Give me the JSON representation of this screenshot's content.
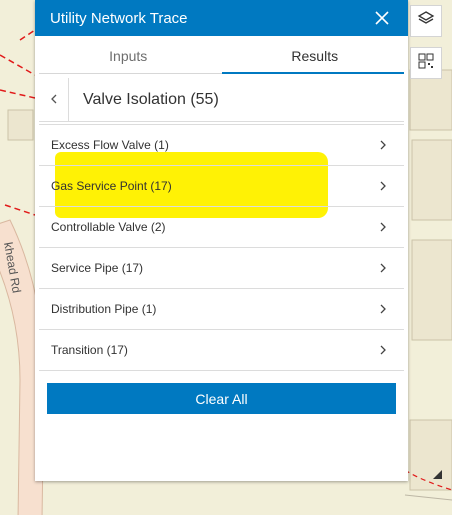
{
  "panel": {
    "title": "Utility Network Trace",
    "tabs": [
      {
        "label": "Inputs",
        "active": false
      },
      {
        "label": "Results",
        "active": true
      }
    ],
    "header_title": "Valve Isolation (55)",
    "results": [
      {
        "label": "Excess Flow Valve (1)"
      },
      {
        "label": "Gas Service Point (17)"
      },
      {
        "label": "Controllable Valve (2)"
      },
      {
        "label": "Service Pipe (17)"
      },
      {
        "label": "Distribution Pipe (1)"
      },
      {
        "label": "Transition (17)"
      }
    ],
    "clear_label": "Clear All"
  },
  "map": {
    "road_label": "khead Rd"
  },
  "colors": {
    "accent": "#0079c1",
    "highlight": "#fff200",
    "map_bg": "#f2efd9",
    "pipe": "#e11a1a"
  },
  "icons": {
    "close": "close-icon",
    "back": "chevron-left-icon",
    "item": "chevron-right-icon",
    "layers": "layers-icon",
    "qr": "grid-icon"
  }
}
